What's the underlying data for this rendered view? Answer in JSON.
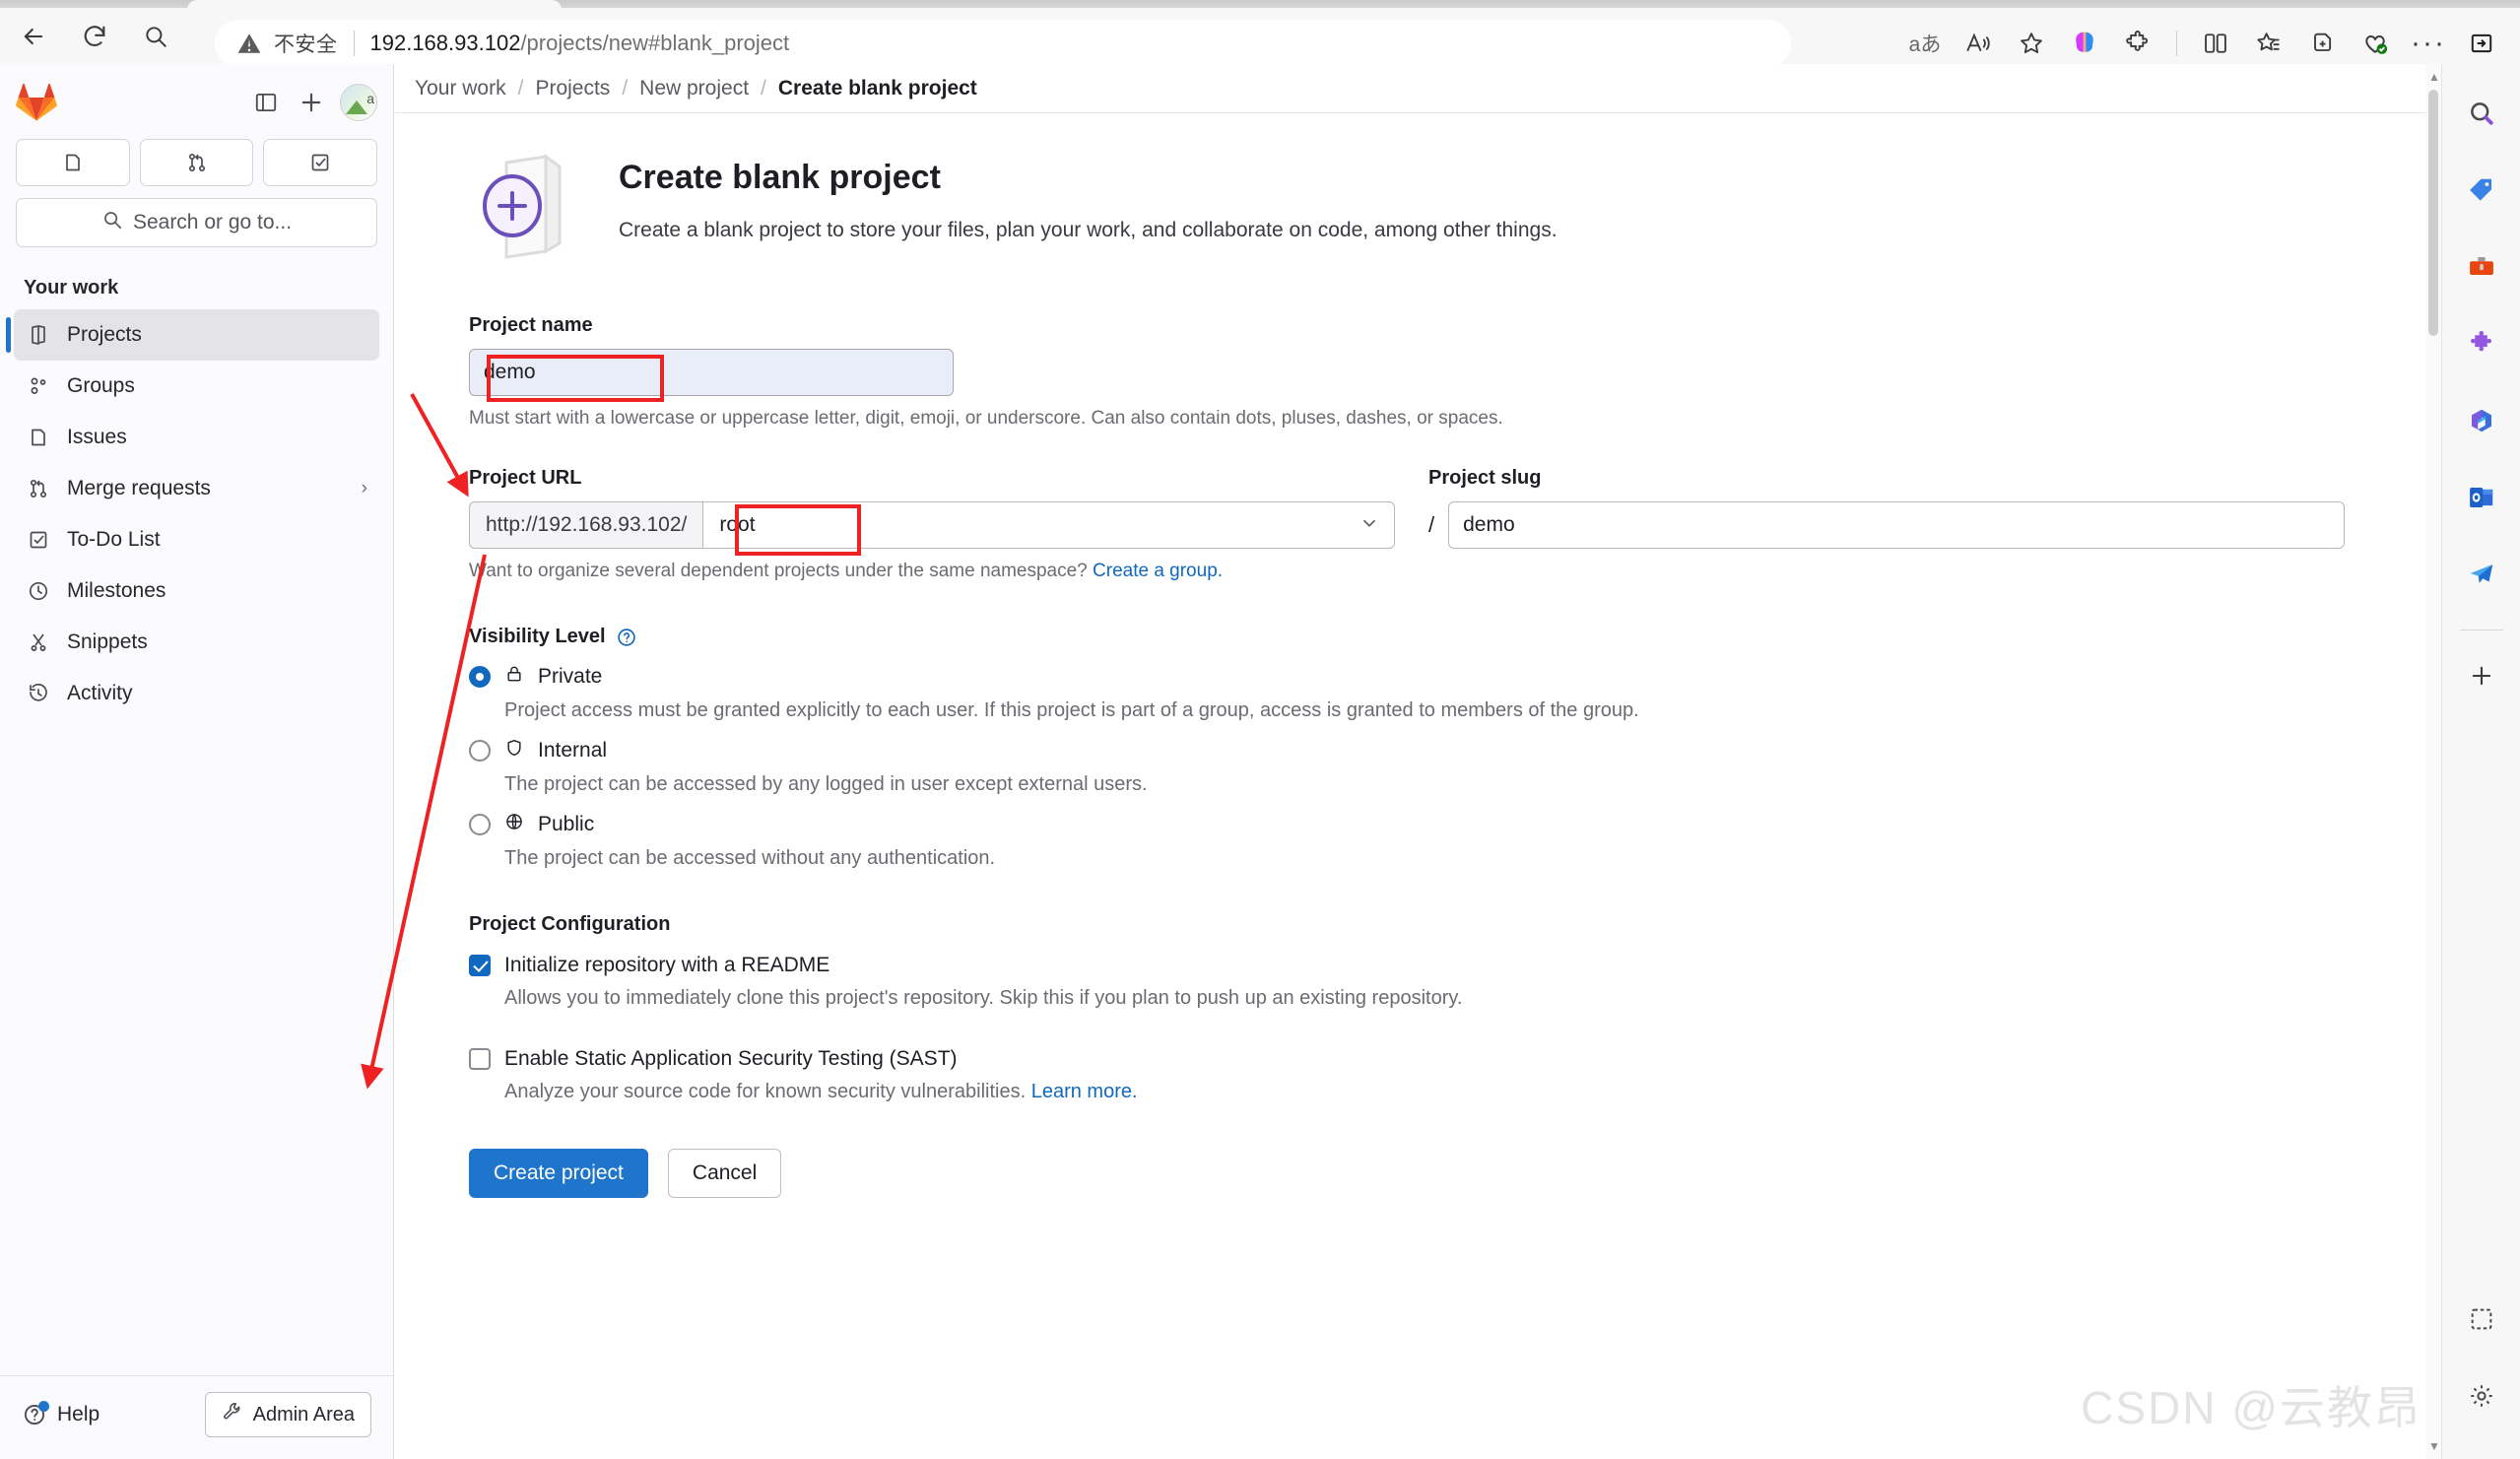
{
  "browser": {
    "nav": {
      "back": "back-arrow",
      "refresh": "refresh",
      "search": "search"
    },
    "omnibox": {
      "security_label": "不安全",
      "url_host": "192.168.93.102",
      "url_path": "/projects/new#blank_project"
    },
    "toolbar_icons": [
      "translate-icon",
      "read-aloud-icon",
      "favorite-star-icon",
      "copilot-icon",
      "extensions-icon",
      "split-screen-icon",
      "collections-icon",
      "copy-tab-icon",
      "browser-essentials-icon",
      "more-options-icon",
      "sidebar-toggle-icon"
    ]
  },
  "sidebar": {
    "logo": "gitlab-logo",
    "top_actions": [
      "collapse-sidebar-icon",
      "create-new-icon",
      "user-avatar"
    ],
    "quick_icons": [
      "issues-icon",
      "merge-requests-icon",
      "todo-icon"
    ],
    "search": {
      "placeholder": "Search or go to..."
    },
    "section_title": "Your work",
    "items": [
      {
        "label": "Projects",
        "icon": "project-icon",
        "active": true,
        "chevron": ""
      },
      {
        "label": "Groups",
        "icon": "group-icon",
        "active": false,
        "chevron": ""
      },
      {
        "label": "Issues",
        "icon": "issues-icon",
        "active": false,
        "chevron": ""
      },
      {
        "label": "Merge requests",
        "icon": "merge-request-icon",
        "active": false,
        "chevron": "›"
      },
      {
        "label": "To-Do List",
        "icon": "todo-icon",
        "active": false,
        "chevron": ""
      },
      {
        "label": "Milestones",
        "icon": "clock-icon",
        "active": false,
        "chevron": ""
      },
      {
        "label": "Snippets",
        "icon": "snippet-icon",
        "active": false,
        "chevron": ""
      },
      {
        "label": "Activity",
        "icon": "history-icon",
        "active": false,
        "chevron": ""
      }
    ],
    "footer": {
      "help_label": "Help",
      "admin_label": "Admin Area"
    }
  },
  "breadcrumb": {
    "items": [
      "Your work",
      "Projects",
      "New project",
      "Create blank project"
    ],
    "separator": "/"
  },
  "main": {
    "title": "Create blank project",
    "subtitle": "Create a blank project to store your files, plan your work, and collaborate on code, among other things.",
    "project_name": {
      "label": "Project name",
      "value": "demo",
      "hint": "Must start with a lowercase or uppercase letter, digit, emoji, or underscore. Can also contain dots, pluses, dashes, or spaces."
    },
    "project_url": {
      "label": "Project URL",
      "prefix": "http://192.168.93.102/",
      "namespace": "root",
      "chevron": "⌄",
      "hint_text": "Want to organize several dependent projects under the same namespace?",
      "hint_link": "Create a group."
    },
    "project_slug": {
      "label": "Project slug",
      "separator": "/",
      "value": "demo"
    },
    "visibility": {
      "label": "Visibility Level",
      "help_icon": "question-circle-icon",
      "options": [
        {
          "label": "Private",
          "icon": "lock-icon",
          "selected": true,
          "desc": "Project access must be granted explicitly to each user. If this project is part of a group, access is granted to members of the group."
        },
        {
          "label": "Internal",
          "icon": "shield-icon",
          "selected": false,
          "desc": "The project can be accessed by any logged in user except external users."
        },
        {
          "label": "Public",
          "icon": "globe-icon",
          "selected": false,
          "desc": "The project can be accessed without any authentication."
        }
      ]
    },
    "configuration": {
      "label": "Project Configuration",
      "items": [
        {
          "label": "Initialize repository with a README",
          "checked": true,
          "desc": "Allows you to immediately clone this project's repository. Skip this if you plan to push up an existing repository.",
          "link": ""
        },
        {
          "label": "Enable Static Application Security Testing (SAST)",
          "checked": false,
          "desc": "Analyze your source code for known security vulnerabilities.",
          "link": "Learn more."
        }
      ]
    },
    "actions": {
      "submit": "Create project",
      "cancel": "Cancel"
    }
  },
  "edge_rail": {
    "icons": [
      "search-icon",
      "shopping-tag-icon",
      "tools-icon",
      "games-puzzle-icon",
      "microsoft365-icon",
      "outlook-icon",
      "paper-plane-icon"
    ],
    "add": "+",
    "bottom": [
      "screenshot-icon",
      "settings-gear-icon"
    ]
  },
  "watermark": "CSDN @云教昂",
  "colors": {
    "accent_blue": "#1f75cb",
    "annotation_red": "#ee2222",
    "gitlab_orange": "#e24329"
  }
}
